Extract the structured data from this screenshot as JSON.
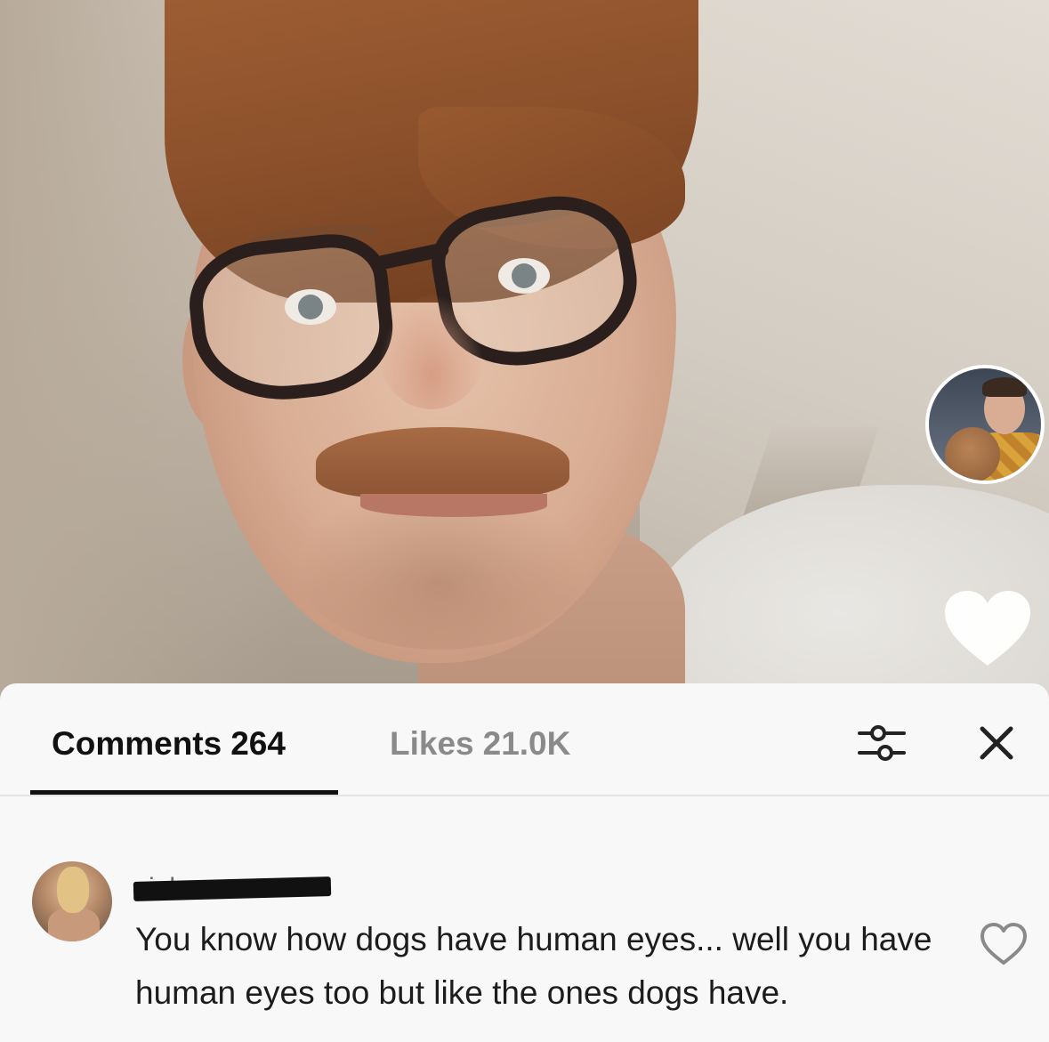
{
  "video": {
    "profile_avatar_icon": "profile-avatar",
    "like_icon": "heart-icon"
  },
  "sheet": {
    "tabs": [
      {
        "label": "Comments",
        "count": "264"
      },
      {
        "label": "Likes",
        "count": "21.0K"
      }
    ],
    "filter_icon": "filter-sliders-icon",
    "close_icon": "close-icon",
    "active_tab_color": "#111111",
    "inactive_tab_color": "#8a8a8a"
  },
  "comment": {
    "username": "viola",
    "text": "You know how dogs have human eyes... well you have human eyes too but like the ones dogs have.",
    "like_icon": "heart-outline-icon"
  }
}
